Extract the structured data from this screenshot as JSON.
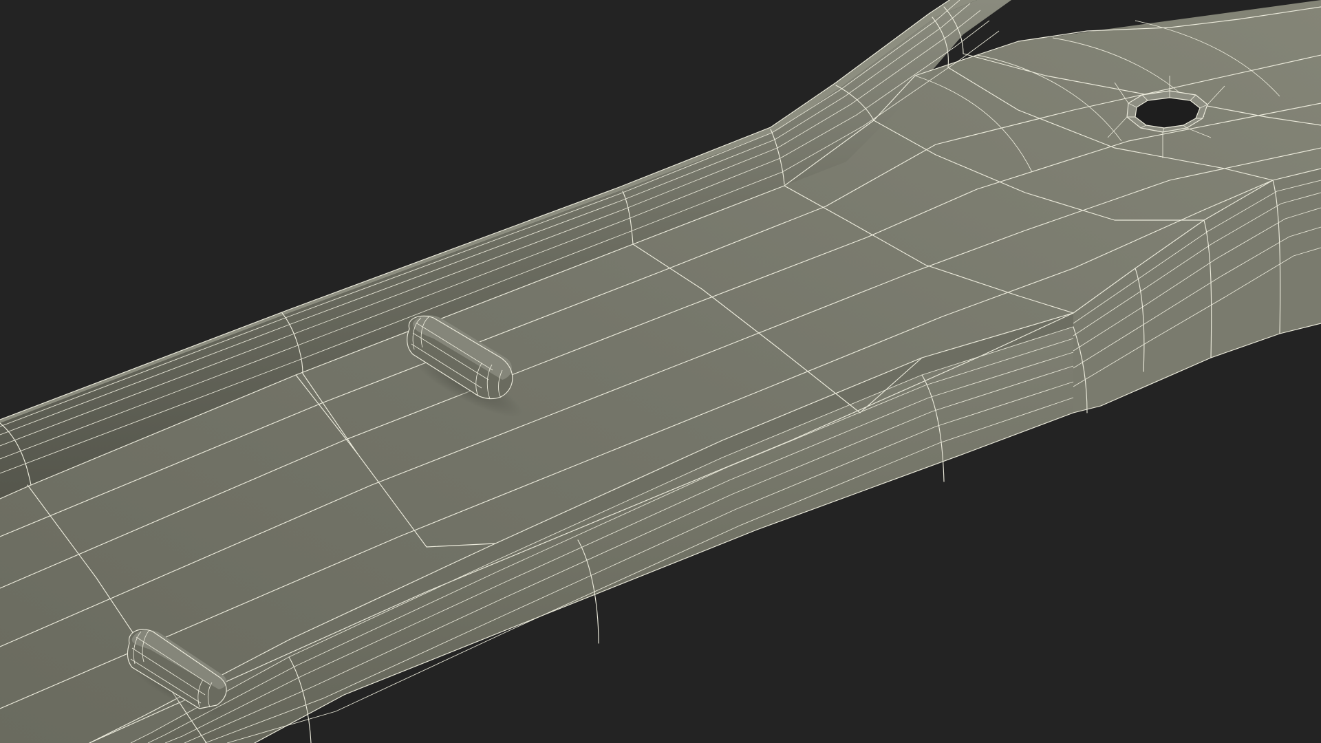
{
  "scene": {
    "subject": "wireframe-tray-model",
    "render_mode": "wireframe-over-shaded",
    "colors": {
      "background": "#232323",
      "surface": "#717265",
      "surface_dark": "#5f6055",
      "surface_light": "#8a8b7d",
      "wall_outer": "#7b7c6f",
      "wire": "#ecebdc",
      "hole": "#1e1e1e"
    },
    "features": [
      "raised-rim-wall",
      "flat-tray-floor",
      "rounded-peg",
      "rounded-peg",
      "octagonal-hole"
    ]
  }
}
